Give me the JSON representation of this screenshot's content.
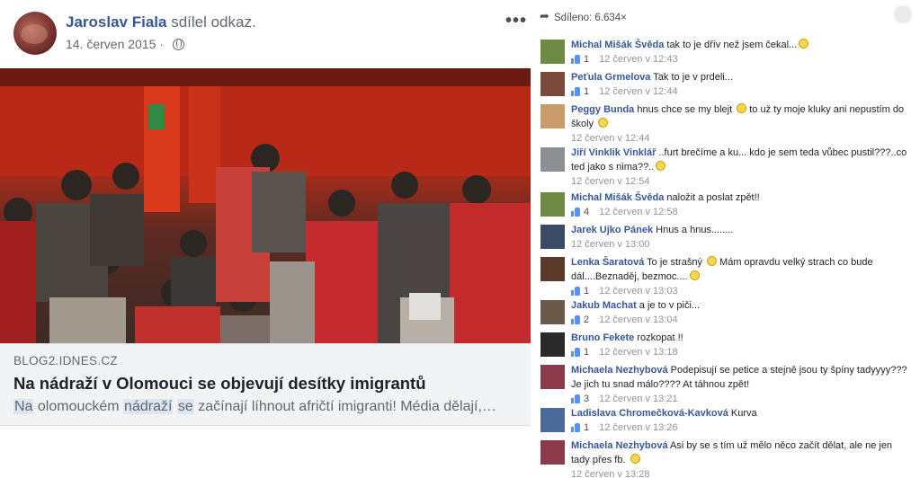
{
  "post": {
    "author": "Jaroslav Fiala",
    "action": " sdílel odkaz.",
    "date": "14. červen 2015",
    "separator": " · ",
    "more_icon": "more-options-icon",
    "privacy_icon": "globe-icon",
    "link": {
      "domain": "BLOG2.IDNES.CZ",
      "title": "Na nádraží v Olomouci se objevují desítky imigrantů",
      "desc_highlight_1": "Na",
      "desc_part_1": " olomouckém ",
      "desc_highlight_2": "nádraží",
      "desc_part_2": " ",
      "desc_highlight_3": "se",
      "desc_part_3": " začínají líhnout afričtí imigranti! Média dělají,…"
    }
  },
  "shares": {
    "label": "Sdíleno: 6.634×",
    "icon": "share-arrow-icon"
  },
  "comments": [
    {
      "author": "Michal Mišák Švěda",
      "text": " tak to je dřív než jsem čekal...",
      "emoji": true,
      "likes": "1",
      "time": "12 červen v 12:43",
      "avatar_color": "#6e8a45"
    },
    {
      "author": "Peťula Grmelova",
      "text": " Tak to je v prdeli...",
      "emoji": false,
      "likes": "1",
      "time": "12 červen v 12:44",
      "avatar_color": "#7a4a3a"
    },
    {
      "author": "Peggy Bunda",
      "text": " hnus chce se my blejt ",
      "text2": " to už ty moje kluky ani nepustím do školy ",
      "emoji": true,
      "likes": "",
      "time": "12 červen v 12:44",
      "avatar_color": "#c99a6a"
    },
    {
      "author": "Jiří Vinklik Vinklář",
      "text": " ..furt brečíme a ku... kdo je sem teda vůbec pustil???..co ted jako s nima??..",
      "emoji": true,
      "likes": "",
      "time": "12 červen v 12:54",
      "avatar_color": "#8c8f93"
    },
    {
      "author": "Michal Mišák Švěda",
      "text": " naložit a poslat zpět!!",
      "emoji": false,
      "likes": "4",
      "time": "12 červen v 12:58",
      "avatar_color": "#6e8a45"
    },
    {
      "author": "Jarek Ujko Pánek",
      "text": " Hnus a hnus........",
      "emoji": false,
      "likes": "",
      "time": "12 červen v 13:00",
      "avatar_color": "#3d4a66"
    },
    {
      "author": "Lenka Šaratová",
      "text": " To je strašný ",
      "text2": " Mám opravdu velký strach co bude dál....Beznaděj, bezmoc....",
      "emoji": true,
      "likes": "1",
      "time": "12 červen v 13:03",
      "avatar_color": "#5a3a2a"
    },
    {
      "author": "Jakub Machat",
      "text": " a je to v piči...",
      "emoji": false,
      "likes": "2",
      "time": "12 červen v 13:04",
      "avatar_color": "#6a5a4a"
    },
    {
      "author": "Bruno Fekete",
      "text": " rozkopat !!",
      "emoji": false,
      "likes": "1",
      "time": "12 červen v 13:18",
      "avatar_color": "#2a2a2a"
    },
    {
      "author": "Michaela Nezhybová",
      "text": " Podepisují se petice a stejně jsou ty špíny tadyyyy??? Je jich tu snad málo???? At táhnou zpět!",
      "emoji": false,
      "likes": "3",
      "time": "12 červen v 13:21",
      "avatar_color": "#8a3a4a"
    },
    {
      "author": "Ladislava Chromečková-Kavková",
      "text": " Kurva",
      "emoji": false,
      "likes": "1",
      "time": "12 červen v 13:26",
      "avatar_color": "#4a6a9a"
    },
    {
      "author": "Michaela Nezhybová",
      "text": " Asi by se s tím už mělo něco začít dělat, ale ne jen tady přes fb. ",
      "emoji": true,
      "likes": "",
      "time": "12 červen v 13:28",
      "avatar_color": "#8a3a4a"
    }
  ]
}
